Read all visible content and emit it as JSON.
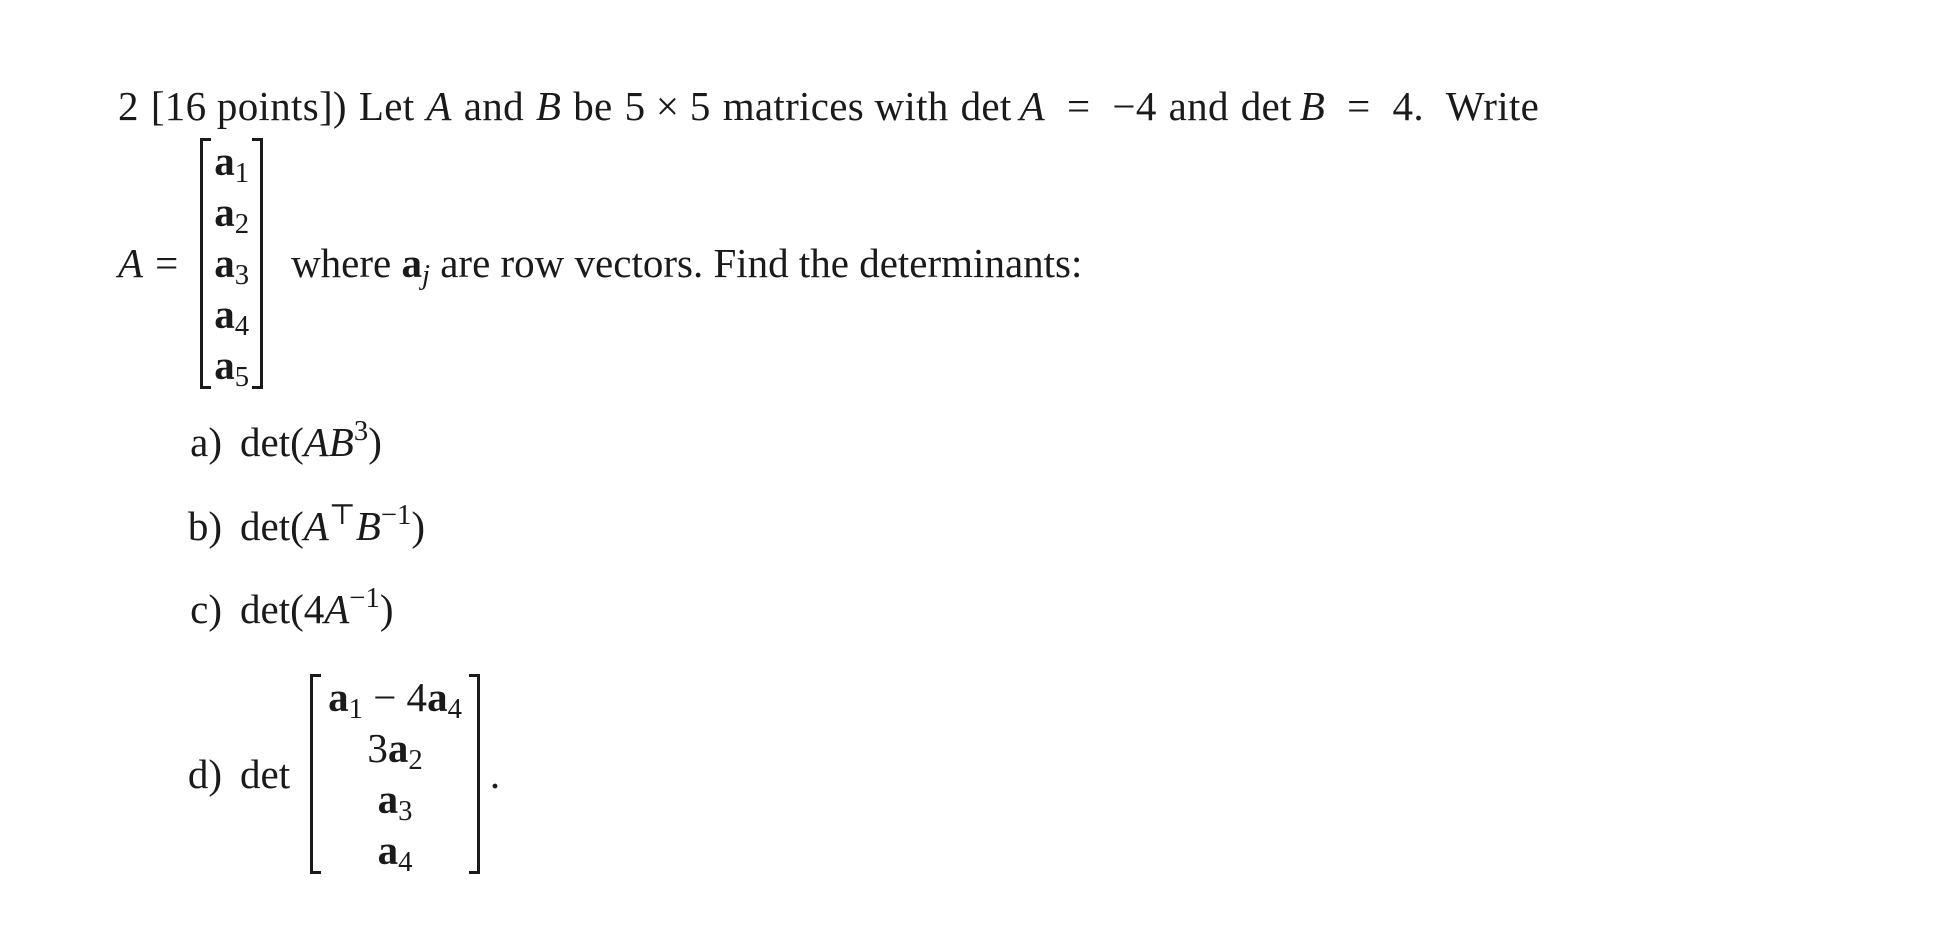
{
  "problem": {
    "number": "2",
    "points": "[16 points])",
    "intro_parts": {
      "let": "Let",
      "A": "A",
      "and1": "and",
      "B": "B",
      "be": "be",
      "dims": "5 × 5",
      "matrices_with": "matrices with",
      "det1": "det",
      "A2": "A",
      "eq1": "=",
      "detA_value": "−4",
      "and2": "and",
      "det2": "det",
      "B2": "B",
      "eq2": "=",
      "detB_value": "4.",
      "write": "Write"
    },
    "matrix_definition": {
      "lhs": "A =",
      "rows": [
        {
          "base": "a",
          "index": "1"
        },
        {
          "base": "a",
          "index": "2"
        },
        {
          "base": "a",
          "index": "3"
        },
        {
          "base": "a",
          "index": "4"
        },
        {
          "base": "a",
          "index": "5"
        }
      ],
      "desc_where": "where",
      "desc_vec": "a",
      "desc_vec_index": "j",
      "desc_rest": "are row vectors. Find the determinants:"
    },
    "parts": [
      {
        "label": "a)",
        "det": "det(",
        "body": "AB",
        "sup": "3",
        "close": ")"
      },
      {
        "label": "b)",
        "det": "det(",
        "body1": "A",
        "sup1": "⊤",
        "body2": "B",
        "sup2": "−1",
        "close": ")"
      },
      {
        "label": "c)",
        "det": "det(",
        "coef": "4",
        "body": "A",
        "sup": "−1",
        "close": ")"
      },
      {
        "label": "d)",
        "det": "det",
        "rows": [
          {
            "p1": "a",
            "i1": "1",
            "op": " − 4",
            "p2": "a",
            "i2": "4"
          },
          {
            "coef": "3",
            "p": "a",
            "i": "2"
          },
          {
            "p": "a",
            "i": "3"
          },
          {
            "p": "a",
            "i": "4"
          }
        ],
        "end": "."
      }
    ]
  }
}
